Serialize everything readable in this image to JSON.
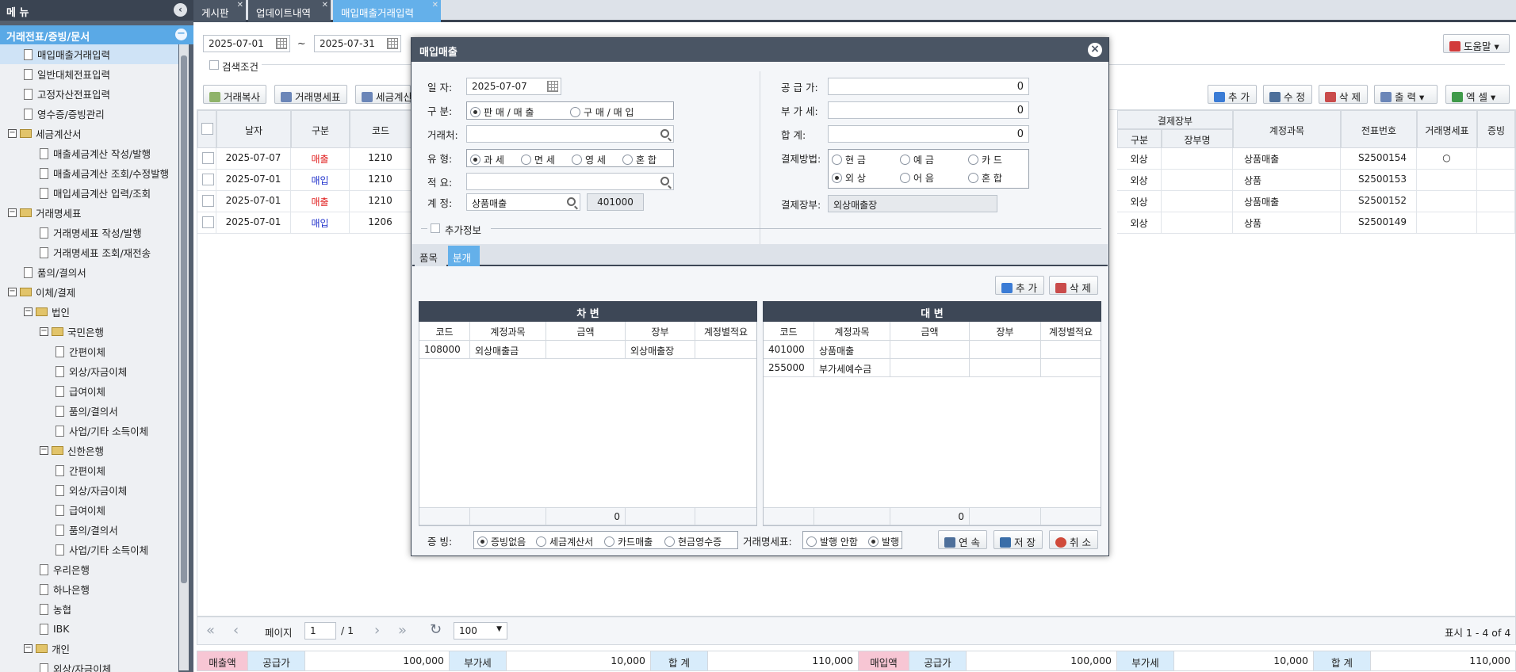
{
  "sidebar": {
    "title": "메 뉴",
    "section": "거래전표/증빙/문서",
    "items": [
      {
        "label": "매입매출거래입력"
      },
      {
        "label": "일반대체전표입력"
      },
      {
        "label": "고정자산전표입력"
      },
      {
        "label": "영수증/증빙관리"
      },
      {
        "label": "세금계산서"
      },
      {
        "label": "매출세금계산 작성/발행"
      },
      {
        "label": "매출세금계산 조회/수정발행"
      },
      {
        "label": "매입세금계산 입력/조회"
      },
      {
        "label": "거래명세표"
      },
      {
        "label": "거래명세표 작성/발행"
      },
      {
        "label": "거래명세표 조회/재전송"
      },
      {
        "label": "품의/결의서"
      },
      {
        "label": "이체/결제"
      },
      {
        "label": "법인"
      },
      {
        "label": "국민은행"
      },
      {
        "label": "간편이체"
      },
      {
        "label": "외상/자금이체"
      },
      {
        "label": "급여이체"
      },
      {
        "label": "품의/결의서"
      },
      {
        "label": "사업/기타 소득이체"
      },
      {
        "label": "신한은행"
      },
      {
        "label": "간편이체"
      },
      {
        "label": "외상/자금이체"
      },
      {
        "label": "급여이체"
      },
      {
        "label": "품의/결의서"
      },
      {
        "label": "사업/기타 소득이체"
      },
      {
        "label": "우리은행"
      },
      {
        "label": "하나은행"
      },
      {
        "label": "농협"
      },
      {
        "label": "IBK"
      },
      {
        "label": "개인"
      },
      {
        "label": "외상/자금이체"
      }
    ]
  },
  "tabs": [
    {
      "label": "게시판"
    },
    {
      "label": "업데이트내역"
    },
    {
      "label": "매입매출거래입력"
    }
  ],
  "main": {
    "date_from": "2025-07-01",
    "tilde": "~",
    "date_to": "2025-07-31",
    "search_condition": "검색조건",
    "help": "도움말",
    "btn_copy": "거래복사",
    "btn_statement": "거래명세표",
    "btn_tax": "세금계산",
    "btn_add": "추 가",
    "btn_edit": "수 정",
    "btn_delete": "삭 제",
    "btn_print": "출 력",
    "btn_excel": "엑 셀",
    "headers": [
      "날자",
      "구분",
      "코드"
    ],
    "right_group": "결제장부",
    "right_sub": [
      "구분",
      "장부명"
    ],
    "right_headers": [
      "계정과목",
      "전표번호",
      "거래명세표",
      "증빙"
    ],
    "rows": [
      {
        "date": "2025-07-07",
        "type": "매출",
        "type_color": "#e02020",
        "code": "1210",
        "pay": "외상",
        "book": "",
        "account": "상품매출",
        "voucher": "S2500154",
        "statement": "○",
        "proof": ""
      },
      {
        "date": "2025-07-01",
        "type": "매입",
        "type_color": "#2233cc",
        "code": "1210",
        "pay": "외상",
        "book": "",
        "account": "상품",
        "voucher": "S2500153",
        "statement": "",
        "proof": ""
      },
      {
        "date": "2025-07-01",
        "type": "매출",
        "type_color": "#e02020",
        "code": "1210",
        "pay": "외상",
        "book": "",
        "account": "상품매출",
        "voucher": "S2500152",
        "statement": "",
        "proof": ""
      },
      {
        "date": "2025-07-01",
        "type": "매입",
        "type_color": "#2233cc",
        "code": "1206",
        "pay": "외상",
        "book": "",
        "account": "상품",
        "voucher": "S2500149",
        "statement": "",
        "proof": ""
      }
    ],
    "pager": {
      "page_label": "페이지",
      "page": "1",
      "total": "/ 1",
      "page_size": "100",
      "summary": "표시 1 - 4 of 4"
    }
  },
  "footer": {
    "sales_label": "매출액",
    "supply_label": "공급가",
    "sales_supply": "100,000",
    "vat_label": "부가세",
    "sales_vat": "10,000",
    "total_label": "합 계",
    "sales_total": "110,000",
    "purchase_label": "매입액",
    "purchase_supply": "100,000",
    "purchase_vat": "10,000",
    "purchase_total": "110,000"
  },
  "modal": {
    "title": "매입매출",
    "date_label": "일      자:",
    "date": "2025-07-07",
    "type_label": "구      분:",
    "type_options": [
      "판 매 / 매 출",
      "구 매 / 매 입"
    ],
    "partner_label": "거래처:",
    "partner": "",
    "kind_label": "유      형:",
    "kind_options": [
      "과 세",
      "면 세",
      "영 세",
      "혼 합"
    ],
    "memo_label": "적      요:",
    "memo": "",
    "account_label": "계      정:",
    "account": "상품매출",
    "account_code": "401000",
    "supply_label": "공 급 가:",
    "supply": "0",
    "vat_label": "부 가 세:",
    "vat": "0",
    "total_label": "합      계:",
    "total": "0",
    "pay_label": "결제방법:",
    "pay_options": [
      "현 금",
      "예 금",
      "카 드",
      "외 상",
      "어 음",
      "혼 합"
    ],
    "book_label": "결제장부:",
    "book": "외상매출장",
    "extra_label": "추가정보",
    "subtabs": [
      "품목",
      "분개"
    ],
    "sub_add": "추 가",
    "sub_delete": "삭 제",
    "debit_title": "차 변",
    "credit_title": "대 변",
    "cols": [
      "코드",
      "계정과목",
      "금액",
      "장부",
      "계정별적요"
    ],
    "debit_rows": [
      {
        "code": "108000",
        "account": "외상매출금",
        "amount": "",
        "book": "외상매출장",
        "memo": ""
      }
    ],
    "credit_rows": [
      {
        "code": "401000",
        "account": "상품매출",
        "amount": "",
        "book": "",
        "memo": ""
      },
      {
        "code": "255000",
        "account": "부가세예수금",
        "amount": "",
        "book": "",
        "memo": ""
      }
    ],
    "debit_sum": "0",
    "credit_sum": "0",
    "proof_label": "증 빙:",
    "proof_options": [
      "증빙없음",
      "세금계산서",
      "카드매출",
      "현금영수증"
    ],
    "statement_label": "거래명세표:",
    "statement_options": [
      "발행 안함",
      "발행"
    ],
    "btn_continue": "연 속",
    "btn_save": "저 장",
    "btn_cancel": "취 소"
  }
}
